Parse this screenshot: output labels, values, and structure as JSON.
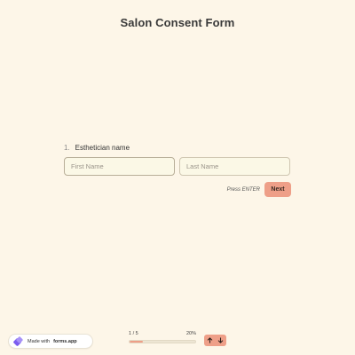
{
  "form": {
    "title": "Salon Consent Form"
  },
  "question": {
    "number": "1.",
    "label": "Esthetician name",
    "first_name_placeholder": "First Name",
    "last_name_placeholder": "Last Name",
    "first_name_value": "",
    "last_name_value": ""
  },
  "actions": {
    "press_prefix": "Press",
    "press_key": "ENTER",
    "next_label": "Next"
  },
  "footer": {
    "badge_prefix": "Made with",
    "badge_brand": "forms.app",
    "progress_count": "1 / 5",
    "progress_percent_text": "20%",
    "progress_fraction": 0.2
  },
  "colors": {
    "background": "#fdf6e8",
    "accent": "#ee9f88",
    "brand_logo": "#7b5cf0"
  },
  "icons": {
    "up": "arrow-up-icon",
    "down": "arrow-down-icon",
    "logo": "forms-app-logo-icon"
  }
}
